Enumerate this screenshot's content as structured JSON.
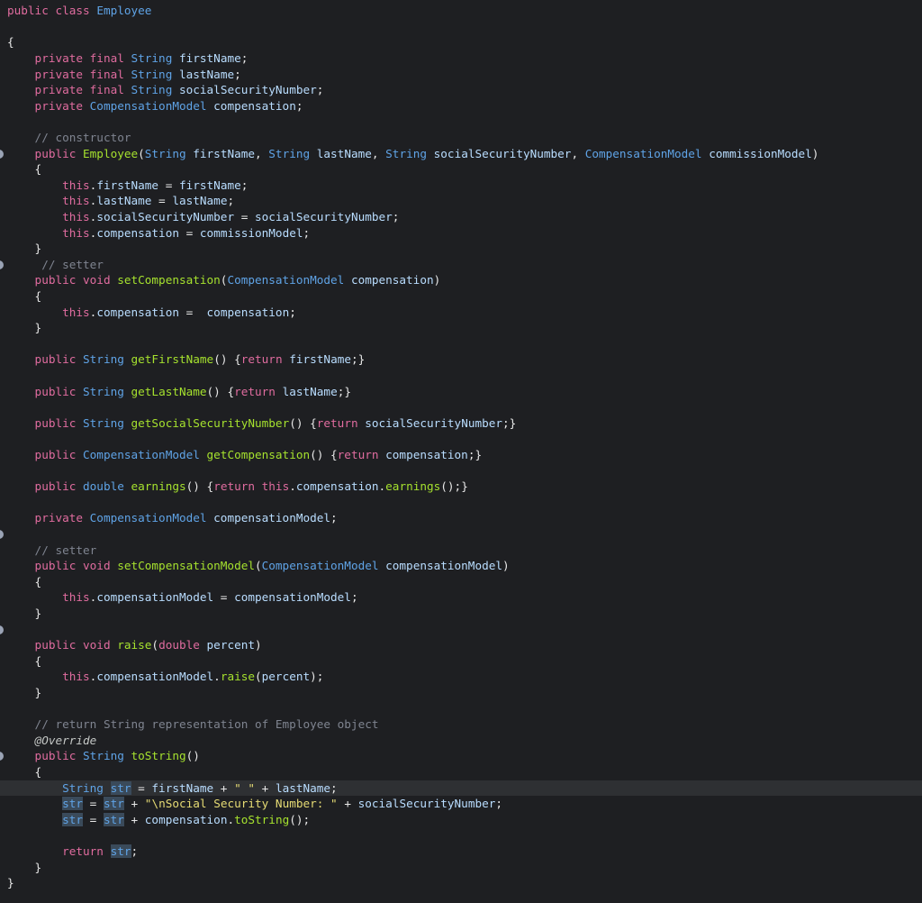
{
  "editor": {
    "language": "java",
    "current_line_index": 49,
    "highlight_word": "str",
    "fold_marker_lines": [
      9,
      16,
      33,
      39,
      47
    ],
    "lines": [
      [
        [
          "kw",
          "public class "
        ],
        [
          "type",
          "Employee"
        ]
      ],
      [],
      [
        [
          "pun",
          "{"
        ]
      ],
      [
        [
          "kw",
          "    private final "
        ],
        [
          "type",
          "String "
        ],
        [
          "id",
          "firstName"
        ],
        [
          "pun",
          ";"
        ]
      ],
      [
        [
          "kw",
          "    private final "
        ],
        [
          "type",
          "String "
        ],
        [
          "id",
          "lastName"
        ],
        [
          "pun",
          ";"
        ]
      ],
      [
        [
          "kw",
          "    private final "
        ],
        [
          "type",
          "String "
        ],
        [
          "id",
          "socialSecurityNumber"
        ],
        [
          "pun",
          ";"
        ]
      ],
      [
        [
          "kw",
          "    private "
        ],
        [
          "type",
          "CompensationModel "
        ],
        [
          "id",
          "compensation"
        ],
        [
          "pun",
          ";"
        ]
      ],
      [],
      [
        [
          "cm",
          "    // constructor"
        ]
      ],
      [
        [
          "kw",
          "    public "
        ],
        [
          "fn",
          "Employee"
        ],
        [
          "pun",
          "("
        ],
        [
          "type",
          "String "
        ],
        [
          "id",
          "firstName"
        ],
        [
          "pun",
          ", "
        ],
        [
          "type",
          "String "
        ],
        [
          "id",
          "lastName"
        ],
        [
          "pun",
          ", "
        ],
        [
          "type",
          "String "
        ],
        [
          "id",
          "socialSecurityNumber"
        ],
        [
          "pun",
          ", "
        ],
        [
          "type",
          "CompensationModel "
        ],
        [
          "id",
          "commissionModel"
        ],
        [
          "pun",
          ")"
        ]
      ],
      [
        [
          "pun",
          "    {"
        ]
      ],
      [
        [
          "kw",
          "        this"
        ],
        [
          "pun",
          "."
        ],
        [
          "id",
          "firstName"
        ],
        [
          "pun",
          " = "
        ],
        [
          "id",
          "firstName"
        ],
        [
          "pun",
          ";"
        ]
      ],
      [
        [
          "kw",
          "        this"
        ],
        [
          "pun",
          "."
        ],
        [
          "id",
          "lastName"
        ],
        [
          "pun",
          " = "
        ],
        [
          "id",
          "lastName"
        ],
        [
          "pun",
          ";"
        ]
      ],
      [
        [
          "kw",
          "        this"
        ],
        [
          "pun",
          "."
        ],
        [
          "id",
          "socialSecurityNumber"
        ],
        [
          "pun",
          " = "
        ],
        [
          "id",
          "socialSecurityNumber"
        ],
        [
          "pun",
          ";"
        ]
      ],
      [
        [
          "kw",
          "        this"
        ],
        [
          "pun",
          "."
        ],
        [
          "id",
          "compensation"
        ],
        [
          "pun",
          " = "
        ],
        [
          "id",
          "commissionModel"
        ],
        [
          "pun",
          ";"
        ]
      ],
      [
        [
          "pun",
          "    }"
        ]
      ],
      [
        [
          "cm",
          "     // setter"
        ]
      ],
      [
        [
          "kw",
          "    public void "
        ],
        [
          "fn",
          "setCompensation"
        ],
        [
          "pun",
          "("
        ],
        [
          "type",
          "CompensationModel "
        ],
        [
          "id",
          "compensation"
        ],
        [
          "pun",
          ")"
        ]
      ],
      [
        [
          "pun",
          "    {"
        ]
      ],
      [
        [
          "kw",
          "        this"
        ],
        [
          "pun",
          "."
        ],
        [
          "id",
          "compensation"
        ],
        [
          "pun",
          " =  "
        ],
        [
          "id",
          "compensation"
        ],
        [
          "pun",
          ";"
        ]
      ],
      [
        [
          "pun",
          "    }"
        ]
      ],
      [],
      [
        [
          "kw",
          "    public "
        ],
        [
          "type",
          "String "
        ],
        [
          "fn",
          "getFirstName"
        ],
        [
          "pun",
          "() {"
        ],
        [
          "kw",
          "return "
        ],
        [
          "id",
          "firstName"
        ],
        [
          "pun",
          ";}"
        ]
      ],
      [],
      [
        [
          "kw",
          "    public "
        ],
        [
          "type",
          "String "
        ],
        [
          "fn",
          "getLastName"
        ],
        [
          "pun",
          "() {"
        ],
        [
          "kw",
          "return "
        ],
        [
          "id",
          "lastName"
        ],
        [
          "pun",
          ";}"
        ]
      ],
      [],
      [
        [
          "kw",
          "    public "
        ],
        [
          "type",
          "String "
        ],
        [
          "fn",
          "getSocialSecurityNumber"
        ],
        [
          "pun",
          "() {"
        ],
        [
          "kw",
          "return "
        ],
        [
          "id",
          "socialSecurityNumber"
        ],
        [
          "pun",
          ";}"
        ]
      ],
      [],
      [
        [
          "kw",
          "    public "
        ],
        [
          "type",
          "CompensationModel "
        ],
        [
          "fn",
          "getCompensation"
        ],
        [
          "pun",
          "() {"
        ],
        [
          "kw",
          "return "
        ],
        [
          "id",
          "compensation"
        ],
        [
          "pun",
          ";}"
        ]
      ],
      [],
      [
        [
          "kw",
          "    public "
        ],
        [
          "type",
          "double "
        ],
        [
          "fn",
          "earnings"
        ],
        [
          "pun",
          "() {"
        ],
        [
          "kw",
          "return this"
        ],
        [
          "pun",
          "."
        ],
        [
          "id",
          "compensation"
        ],
        [
          "pun",
          "."
        ],
        [
          "fn",
          "earnings"
        ],
        [
          "pun",
          "();}"
        ]
      ],
      [],
      [
        [
          "kw",
          "    private "
        ],
        [
          "type",
          "CompensationModel "
        ],
        [
          "id",
          "compensationModel"
        ],
        [
          "pun",
          ";"
        ]
      ],
      [],
      [
        [
          "cm",
          "    // setter"
        ]
      ],
      [
        [
          "kw",
          "    public void "
        ],
        [
          "fn",
          "setCompensationModel"
        ],
        [
          "pun",
          "("
        ],
        [
          "type",
          "CompensationModel "
        ],
        [
          "id",
          "compensationModel"
        ],
        [
          "pun",
          ")"
        ]
      ],
      [
        [
          "pun",
          "    {"
        ]
      ],
      [
        [
          "kw",
          "        this"
        ],
        [
          "pun",
          "."
        ],
        [
          "id",
          "compensationModel"
        ],
        [
          "pun",
          " = "
        ],
        [
          "id",
          "compensationModel"
        ],
        [
          "pun",
          ";"
        ]
      ],
      [
        [
          "pun",
          "    }"
        ]
      ],
      [],
      [
        [
          "kw",
          "    public void "
        ],
        [
          "fn",
          "raise"
        ],
        [
          "pun",
          "("
        ],
        [
          "kw",
          "double "
        ],
        [
          "id",
          "percent"
        ],
        [
          "pun",
          ")"
        ]
      ],
      [
        [
          "pun",
          "    {"
        ]
      ],
      [
        [
          "kw",
          "        this"
        ],
        [
          "pun",
          "."
        ],
        [
          "id",
          "compensationModel"
        ],
        [
          "pun",
          "."
        ],
        [
          "fn",
          "raise"
        ],
        [
          "pun",
          "("
        ],
        [
          "id",
          "percent"
        ],
        [
          "pun",
          ");"
        ]
      ],
      [
        [
          "pun",
          "    }"
        ]
      ],
      [],
      [
        [
          "cm",
          "    // return String representation of Employee object"
        ]
      ],
      [
        [
          "an",
          "    @Override"
        ]
      ],
      [
        [
          "kw",
          "    public "
        ],
        [
          "type",
          "String "
        ],
        [
          "fn",
          "toString"
        ],
        [
          "pun",
          "()"
        ]
      ],
      [
        [
          "pun",
          "    {"
        ]
      ],
      [
        [
          "type",
          "        String "
        ],
        [
          "hl",
          "str"
        ],
        [
          "pun",
          " = "
        ],
        [
          "id",
          "firstName"
        ],
        [
          "pun",
          " + "
        ],
        [
          "str",
          "\" \""
        ],
        [
          "pun",
          " + "
        ],
        [
          "id",
          "lastName"
        ],
        [
          "pun",
          ";"
        ]
      ],
      [
        [
          "hl",
          "        str"
        ],
        [
          "pun",
          " = "
        ],
        [
          "hl",
          "str"
        ],
        [
          "pun",
          " + "
        ],
        [
          "str",
          "\""
        ],
        [
          "esc",
          "\\n"
        ],
        [
          "str",
          "Social Security Number: \""
        ],
        [
          "pun",
          " + "
        ],
        [
          "id",
          "socialSecurityNumber"
        ],
        [
          "pun",
          ";"
        ]
      ],
      [
        [
          "hl",
          "        str"
        ],
        [
          "pun",
          " = "
        ],
        [
          "hl",
          "str"
        ],
        [
          "pun",
          " + "
        ],
        [
          "id",
          "compensation"
        ],
        [
          "pun",
          "."
        ],
        [
          "fn",
          "toString"
        ],
        [
          "pun",
          "();"
        ]
      ],
      [],
      [
        [
          "kw",
          "        return "
        ],
        [
          "hl",
          "str"
        ],
        [
          "pun",
          ";"
        ]
      ],
      [
        [
          "pun",
          "    }"
        ]
      ],
      [
        [
          "pun",
          "}"
        ]
      ]
    ]
  }
}
